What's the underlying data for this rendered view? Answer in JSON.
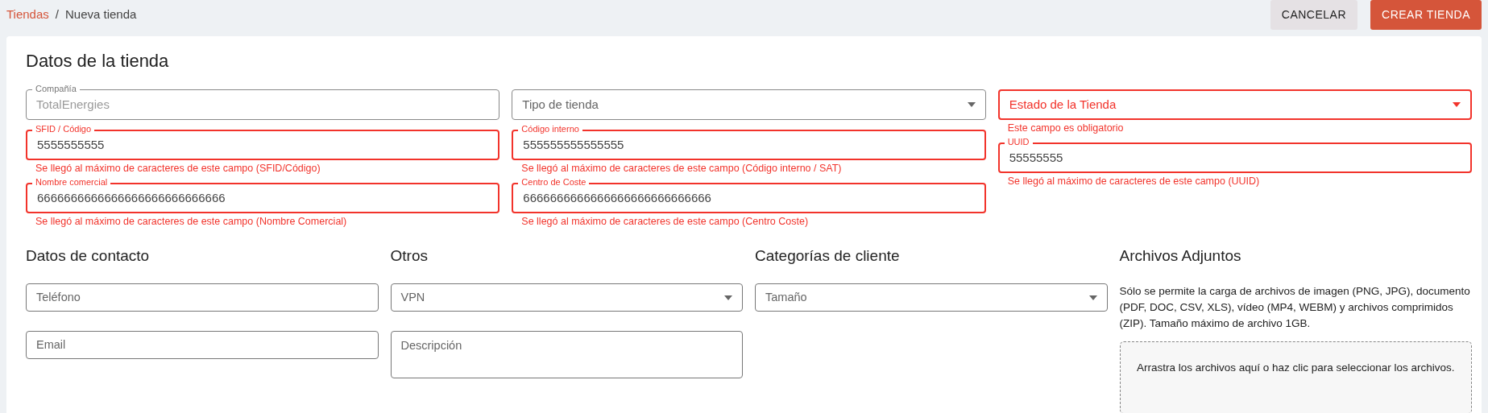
{
  "breadcrumb": [
    {
      "label": "Tiendas",
      "link": true
    },
    {
      "separator": "/",
      "label": "Nueva tienda",
      "link": false
    }
  ],
  "actions": [
    {
      "label": "CANCELAR",
      "kind": "secondary"
    },
    {
      "label": "CREAR TIENDA",
      "kind": "primary"
    }
  ],
  "store_section": {
    "title": "Datos de la tienda",
    "columns": [
      [
        {
          "kind": "text",
          "label": "Compañía",
          "value": "TotalEnergies",
          "disabled": true,
          "invalid": false
        },
        {
          "kind": "text",
          "label": "SFID / Código",
          "value": "5555555555",
          "invalid": true,
          "error": "Se llegó al máximo de caracteres de este campo (SFID/Código)"
        },
        {
          "kind": "text",
          "label": "Nombre comercial",
          "value": "6666666666666666666666666666",
          "invalid": true,
          "error": "Se llegó al máximo de caracteres de este campo (Nombre Comercial)"
        }
      ],
      [
        {
          "kind": "select",
          "placeholder": "Tipo de tienda",
          "invalid": false
        },
        {
          "kind": "text",
          "label": "Código interno",
          "value": "555555555555555",
          "invalid": true,
          "error": "Se llegó al máximo de caracteres de este campo (Código interno / SAT)"
        },
        {
          "kind": "text",
          "label": "Centro de Coste",
          "value": "6666666666666666666666666666",
          "invalid": true,
          "error": "Se llegó al máximo de caracteres de este campo (Centro Coste)"
        }
      ],
      [
        {
          "kind": "select",
          "placeholder": "Estado de la Tienda",
          "invalid": true,
          "error": "Este campo es obligatorio"
        },
        {
          "kind": "text",
          "label": "UUID",
          "value": "55555555",
          "invalid": true,
          "error": "Se llegó al máximo de caracteres de este campo (UUID)"
        }
      ]
    ]
  },
  "sections": [
    {
      "title": "Datos de contacto",
      "items": [
        {
          "kind": "text",
          "placeholder": "Teléfono"
        },
        {
          "kind": "text",
          "placeholder": "Email"
        }
      ]
    },
    {
      "title": "Otros",
      "items": [
        {
          "kind": "select",
          "placeholder": "VPN"
        },
        {
          "kind": "textarea",
          "placeholder": "Descripción"
        }
      ]
    },
    {
      "title": "Categorías de cliente",
      "items": [
        {
          "kind": "select",
          "placeholder": "Tamaño"
        }
      ]
    },
    {
      "title": "Archivos Adjuntos",
      "items": [
        {
          "kind": "note",
          "text": "Sólo se permite la carga de archivos de imagen (PNG, JPG), documento (PDF, DOC, CSV, XLS), vídeo (MP4, WEBM) y archivos comprimidos (ZIP). Tamaño máximo de archivo 1GB."
        },
        {
          "kind": "dropzone",
          "text": "Arrastra los archivos aquí o haz clic para seleccionar los archivos."
        }
      ]
    }
  ]
}
